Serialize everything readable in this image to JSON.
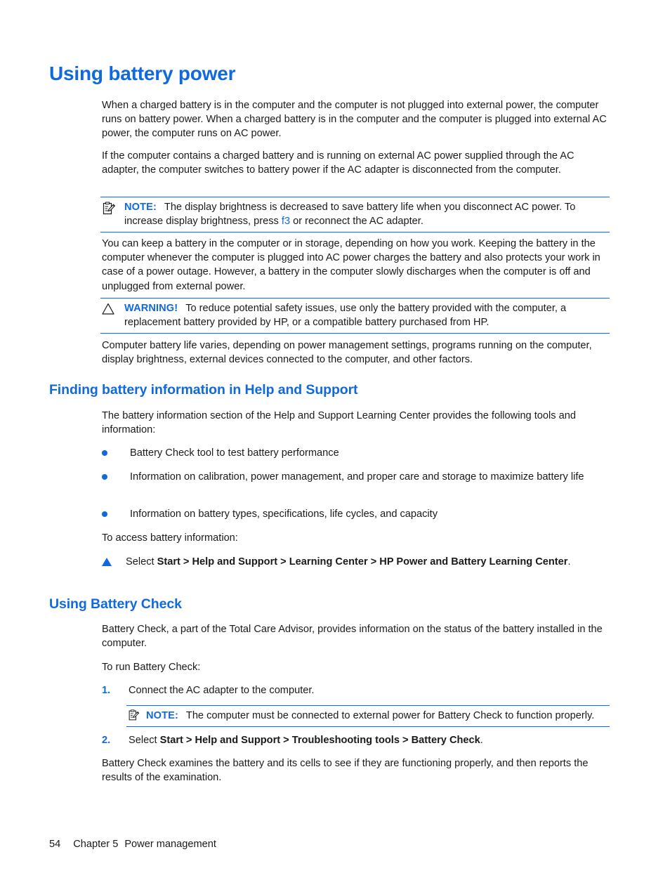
{
  "page": {
    "title": "Using battery power",
    "accent_color": "#1169e0",
    "text_color": "#1a1a1a"
  },
  "paragraphs": {
    "p1": "When a charged battery is in the computer and the computer is not plugged into external power, the computer runs on battery power. When a charged battery is in the computer and the computer is plugged into external AC power, the computer runs on AC power.",
    "p2": "If the computer contains a charged battery and is running on external AC power supplied through the AC adapter, the computer switches to battery power if the AC adapter is disconnected from the computer.",
    "p3": "You can keep a battery in the computer or in storage, depending on how you work. Keeping the battery in the computer whenever the computer is plugged into AC power charges the battery and also protects your work in case of a power outage. However, a battery in the computer slowly discharges when the computer is off and unplugged from external power.",
    "p4": "Computer battery life varies, depending on power management settings, programs running on the computer, display brightness, external devices connected to the computer, and other factors.",
    "p5": "The battery information section of the Help and Support Learning Center provides the following tools and information:",
    "p6": "To access battery information:",
    "p7": "Battery Check, a part of the Total Care Advisor, provides information on the status of the battery installed in the computer.",
    "p8": "To run Battery Check:",
    "p9": "Battery Check examines the battery and its cells to see if they are functioning properly, and then reports the results of the examination."
  },
  "note1": {
    "icon": "note-clipboard-icon",
    "label": "NOTE:",
    "text_before_key": "The display brightness is decreased to save battery life when you disconnect AC power. To increase display brightness, press ",
    "key": "f3",
    "text_after_key": " or reconnect the AC adapter."
  },
  "warning": {
    "icon": "warning-triangle-icon",
    "label": "WARNING!",
    "text": "To reduce potential safety issues, use only the battery provided with the computer, a replacement battery provided by HP, or a compatible battery purchased from HP."
  },
  "note2": {
    "icon": "note-clipboard-icon",
    "label": "NOTE:",
    "text": "The computer must be connected to external power for Battery Check to function properly."
  },
  "headings": {
    "h2_finding": "Finding battery information in Help and Support",
    "h2_using_check": "Using Battery Check"
  },
  "bullets": [
    "Battery Check tool to test battery performance",
    "Information on calibration, power management, and proper care and storage to maximize battery life",
    "Information on battery types, specifications, life cycles, and capacity"
  ],
  "access_step": {
    "marker": "triangle-bullet-icon",
    "prefix": "Select ",
    "path": "Start > Help and Support > Learning Center > HP Power and Battery Learning Center",
    "suffix": "."
  },
  "steps": [
    {
      "number": "1.",
      "text": "Connect the AC adapter to the computer.",
      "bold_path": "",
      "suffix": ""
    },
    {
      "number": "2.",
      "text": "Select ",
      "bold_path": "Start > Help and Support > Troubleshooting tools > Battery Check",
      "suffix": "."
    }
  ],
  "footer": {
    "page_number": "54",
    "chapter": "Chapter 5",
    "chapter_title": "Power management"
  }
}
